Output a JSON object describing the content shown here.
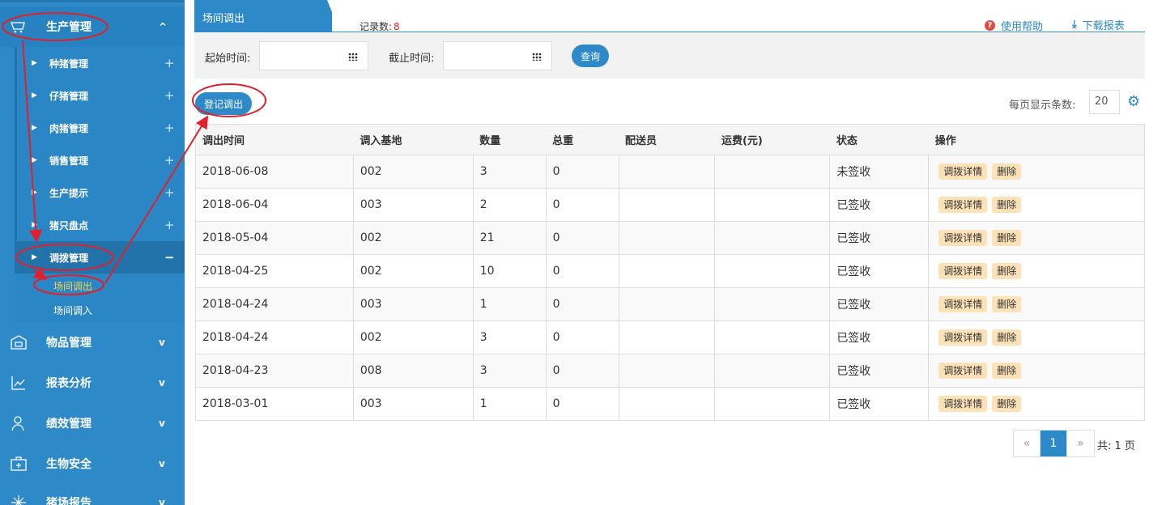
{
  "sidebar": {
    "main_items": [
      {
        "label": "生产管理",
        "icon": "cart-icon",
        "chevron": "^"
      },
      {
        "label": "物品管理",
        "icon": "warehouse-icon",
        "chevron": "v"
      },
      {
        "label": "报表分析",
        "icon": "chart-icon",
        "chevron": "v"
      },
      {
        "label": "绩效管理",
        "icon": "user-icon",
        "chevron": "v"
      },
      {
        "label": "生物安全",
        "icon": "medkit-icon",
        "chevron": "v"
      },
      {
        "label": "猪场报告",
        "icon": "report-icon",
        "chevron": "v"
      }
    ],
    "sub_items": [
      {
        "label": "种猪管理",
        "sign": "+"
      },
      {
        "label": "仔猪管理",
        "sign": "+"
      },
      {
        "label": "肉猪管理",
        "sign": "+"
      },
      {
        "label": "销售管理",
        "sign": "+"
      },
      {
        "label": "生产提示",
        "sign": "+"
      },
      {
        "label": "猪只盘点",
        "sign": "+"
      },
      {
        "label": "调拨管理",
        "sign": "−"
      }
    ],
    "leaves": [
      {
        "label": "场间调出"
      },
      {
        "label": "场间调入"
      }
    ]
  },
  "tabbar": {
    "active_tab": "场间调出",
    "record_label": "记录数:",
    "record_count": "8",
    "help_label": "使用帮助",
    "download_label": "下载报表"
  },
  "filter": {
    "start_label": "起始时间:",
    "end_label": "截止时间:",
    "query_label": "查询"
  },
  "toolbar": {
    "register_label": "登记调出",
    "per_page_label": "每页显示条数:",
    "per_page_value": "20"
  },
  "table": {
    "headers": [
      "调出时间",
      "调入基地",
      "数量",
      "总重",
      "配送员",
      "运费(元)",
      "状态",
      "操作"
    ],
    "detail_label": "调拨详情",
    "delete_label": "删除",
    "rows": [
      {
        "date": "2018-06-08",
        "base": "002",
        "qty": "3",
        "weight": "0",
        "courier": "",
        "freight": "",
        "status": "未签收"
      },
      {
        "date": "2018-06-04",
        "base": "003",
        "qty": "2",
        "weight": "0",
        "courier": "",
        "freight": "",
        "status": "已签收"
      },
      {
        "date": "2018-05-04",
        "base": "002",
        "qty": "21",
        "weight": "0",
        "courier": "",
        "freight": "",
        "status": "已签收"
      },
      {
        "date": "2018-04-25",
        "base": "002",
        "qty": "10",
        "weight": "0",
        "courier": "",
        "freight": "",
        "status": "已签收"
      },
      {
        "date": "2018-04-24",
        "base": "003",
        "qty": "1",
        "weight": "0",
        "courier": "",
        "freight": "",
        "status": "已签收"
      },
      {
        "date": "2018-04-24",
        "base": "002",
        "qty": "3",
        "weight": "0",
        "courier": "",
        "freight": "",
        "status": "已签收"
      },
      {
        "date": "2018-04-23",
        "base": "008",
        "qty": "3",
        "weight": "0",
        "courier": "",
        "freight": "",
        "status": "已签收"
      },
      {
        "date": "2018-03-01",
        "base": "003",
        "qty": "1",
        "weight": "0",
        "courier": "",
        "freight": "",
        "status": "已签收"
      }
    ]
  },
  "pagination": {
    "prev": "«",
    "current": "1",
    "next": "»",
    "total_label": "共: 1 页"
  },
  "colors": {
    "primary": "#2d89c8",
    "annotation": "#e0202c",
    "tag_bg": "#fde2b8"
  }
}
